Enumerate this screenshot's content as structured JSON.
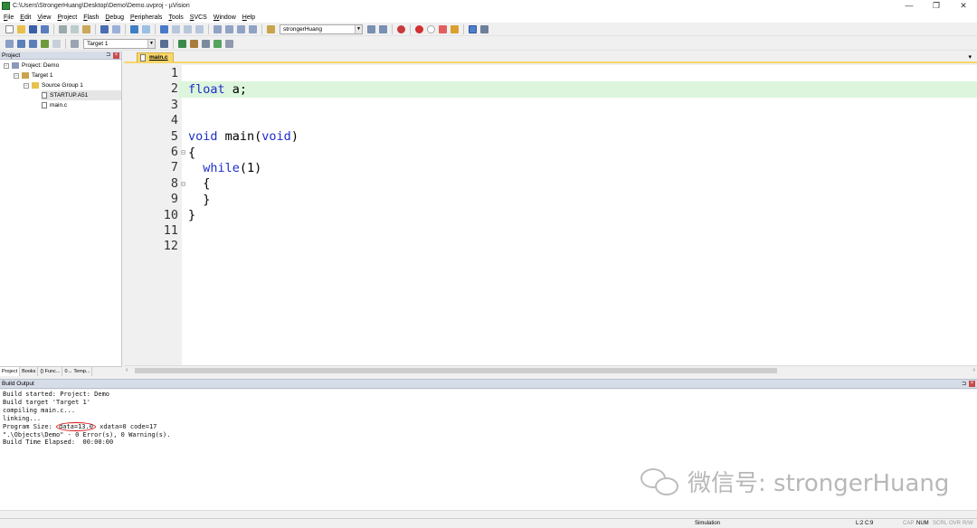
{
  "window": {
    "title": "C:\\Users\\StrongerHuang\\Desktop\\Demo\\Demo.uvproj - µVision",
    "controls": [
      "—",
      "❐",
      "✕"
    ]
  },
  "menu": [
    "File",
    "Edit",
    "View",
    "Project",
    "Flash",
    "Debug",
    "Peripherals",
    "Tools",
    "SVCS",
    "Window",
    "Help"
  ],
  "toolbar": {
    "search_combo": "strongerHuang",
    "target_combo": "Target 1"
  },
  "project_panel": {
    "title": "Project",
    "tree": [
      {
        "label": "Project: Demo",
        "level": 0,
        "expander": "−",
        "icon": "project-icon"
      },
      {
        "label": "Target 1",
        "level": 1,
        "expander": "−",
        "icon": "target-icon"
      },
      {
        "label": "Source Group 1",
        "level": 2,
        "expander": "−",
        "icon": "folder-icon"
      },
      {
        "label": "STARTUP.A51",
        "level": 3,
        "expander": "",
        "icon": "file-icon",
        "selected": true
      },
      {
        "label": "main.c",
        "level": 3,
        "expander": "",
        "icon": "file-icon"
      }
    ],
    "tabs": [
      "Project",
      "Books",
      "{} Func...",
      "0→ Temp..."
    ]
  },
  "editor": {
    "tab_label": "main.c",
    "lines": [
      {
        "n": "1",
        "fold": "",
        "html": ""
      },
      {
        "n": "2",
        "fold": "",
        "html": "<span class=\"kw\">float</span> a;",
        "highlight": true
      },
      {
        "n": "3",
        "fold": "",
        "html": ""
      },
      {
        "n": "4",
        "fold": "",
        "html": ""
      },
      {
        "n": "5",
        "fold": "",
        "html": "<span class=\"kw\">void</span> main(<span class=\"kw\">void</span>)"
      },
      {
        "n": "6",
        "fold": "⊟",
        "html": "{"
      },
      {
        "n": "7",
        "fold": "",
        "html": "  <span class=\"kw\">while</span>(1)"
      },
      {
        "n": "8",
        "fold": "⊟",
        "html": "  {"
      },
      {
        "n": "9",
        "fold": "",
        "html": "  }"
      },
      {
        "n": "10",
        "fold": "",
        "html": "}"
      },
      {
        "n": "11",
        "fold": "",
        "html": ""
      },
      {
        "n": "12",
        "fold": "",
        "html": ""
      }
    ]
  },
  "build_output": {
    "title": "Build Output",
    "lines": [
      "Build started: Project: Demo",
      "Build target 'Target 1'",
      "compiling main.c...",
      "linking...",
      "Program Size: ",
      "\".\\Objects\\Demo\" - 0 Error(s), 0 Warning(s).",
      "Build Time Elapsed:  00:00:00"
    ],
    "size_circled": "data=13.0",
    "size_rest": " xdata=0 code=17"
  },
  "watermark": "微信号: strongerHuang",
  "status": {
    "mode": "Simulation",
    "position": "L:2 C:9",
    "flags": [
      "CAP",
      "NUM",
      "SCRL",
      "OVR",
      "R/W"
    ]
  }
}
